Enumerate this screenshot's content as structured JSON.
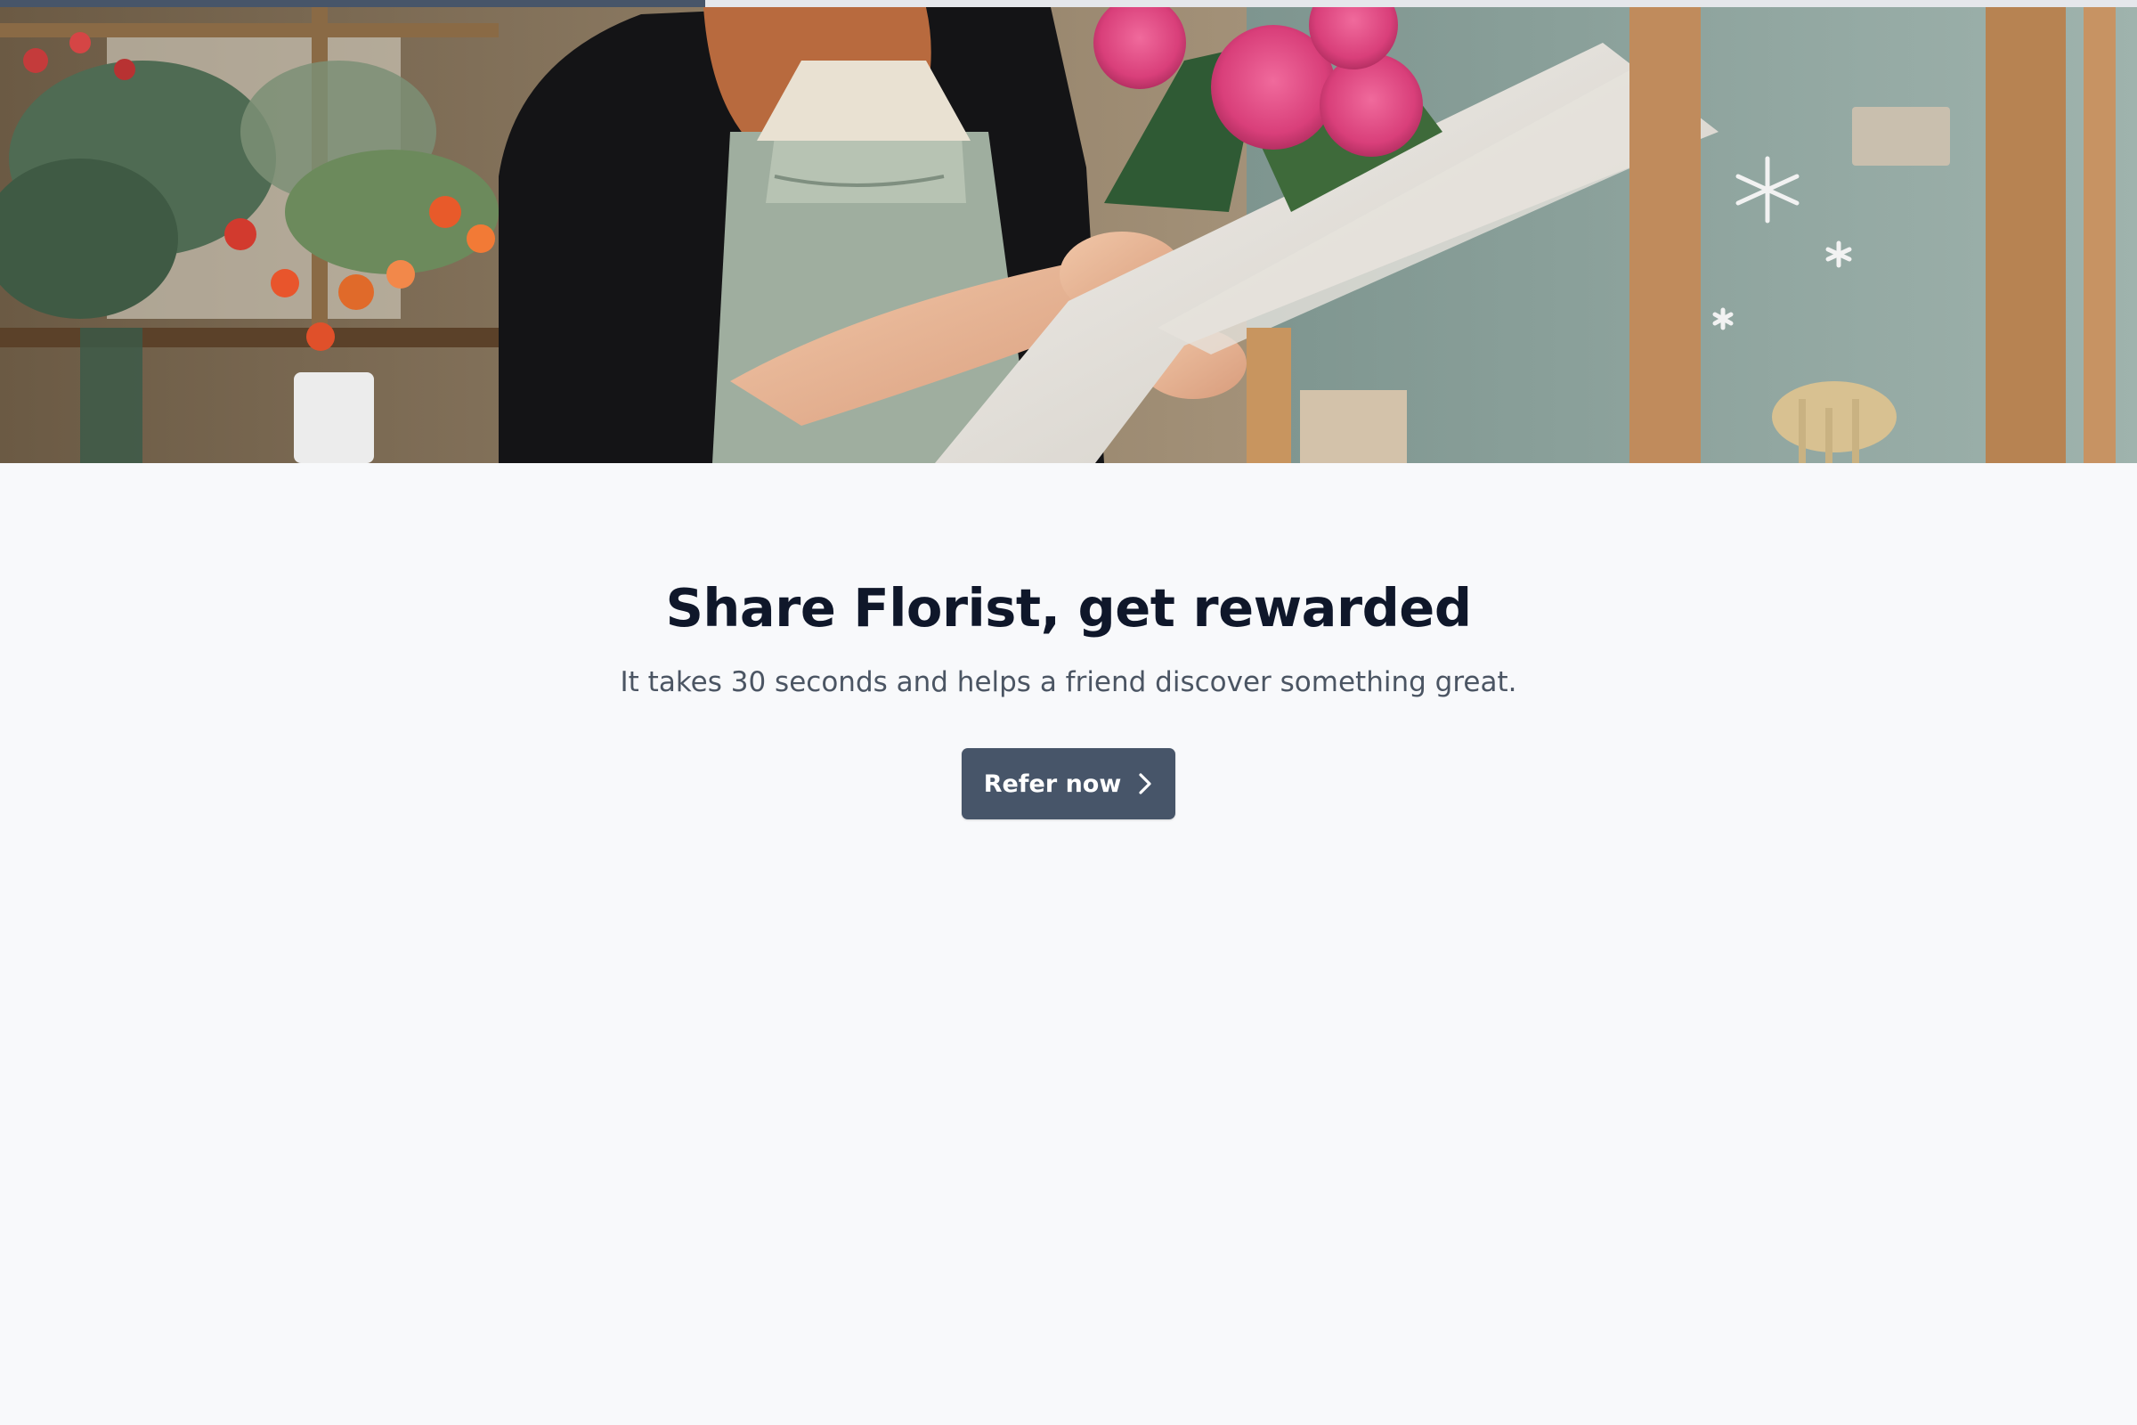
{
  "progress": {
    "value": 0.33
  },
  "hero": {
    "image_subject": "florist holding a bouquet of pink roses wrapped in white paper in a flower shop"
  },
  "referral": {
    "title": "Share Florist, get rewarded",
    "subtitle": "It takes 30 seconds and helps a friend discover something great.",
    "cta_label": "Refer now",
    "cta_icon": "chevron-right-icon"
  },
  "colors": {
    "background": "#f8f9fb",
    "title": "#0f172a",
    "subtitle": "#4b5563",
    "button": "#475569",
    "button_text": "#ffffff"
  }
}
